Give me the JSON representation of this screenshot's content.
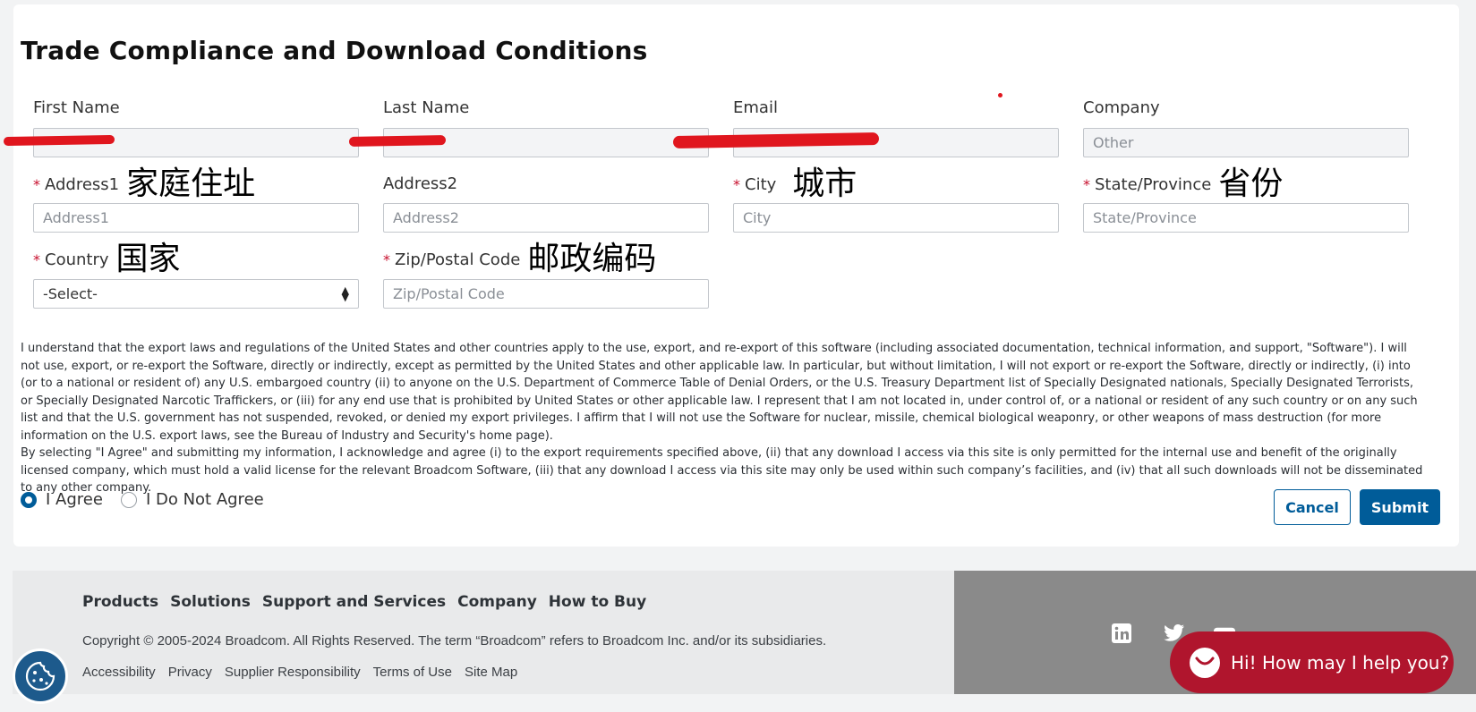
{
  "form": {
    "title": "Trade Compliance and Download Conditions",
    "fields": {
      "first_name": {
        "label": "First Name",
        "value": ""
      },
      "last_name": {
        "label": "Last Name",
        "value": ""
      },
      "email": {
        "label": "Email",
        "value": ""
      },
      "company": {
        "label": "Company",
        "placeholder": "Other"
      },
      "address1": {
        "label": "Address1",
        "note": "家庭住址",
        "placeholder": "Address1"
      },
      "address2": {
        "label": "Address2",
        "placeholder": "Address2"
      },
      "city": {
        "label": "City",
        "note": "城市",
        "placeholder": "City"
      },
      "state": {
        "label": "State/Province",
        "note": "省份",
        "placeholder": "State/Province"
      },
      "country": {
        "label": "Country",
        "note": "国家",
        "selected": "-Select-"
      },
      "zip": {
        "label": "Zip/Postal Code",
        "note": "邮政编码",
        "placeholder": "Zip/Postal Code"
      }
    },
    "required_mark": "*",
    "terms_p1": "I understand that the export laws and regulations of the United States and other countries apply to the use, export, and re-export of this software (including associated documentation, technical information, and support, \"Software\"). I will not use, export, or re-export the Software, directly or indirectly, except as permitted by the United States and other applicable law. In particular, but without limitation, I will not export or re-export the Software, directly or indirectly, (i) into (or to a national or resident of) any U.S. embargoed country (ii) to anyone on the U.S. Department of Commerce Table of Denial Orders, or the U.S. Treasury Department list of Specially Designated nationals, Specially Designated Terrorists, or Specially Designated Narcotic Traffickers, or (iii) for any end use that is prohibited by United States or other applicable law. I represent that I am not located in, under control of, or a national or resident of any such country or on any such list and that the U.S. government has not suspended, revoked, or denied my export privileges. I affirm that I will not use the Software for nuclear, missile, chemical biological weaponry, or other weapons of mass destruction (for more information on the U.S. export laws, see the Bureau of Industry and Security's home page).",
    "terms_p2": "By selecting \"I Agree\" and submitting my information, I acknowledge and agree (i) to the export requirements specified above, (ii) that any download I access via this site is only permitted for the internal use and benefit of the originally licensed company, which must hold a valid license for the relevant Broadcom Software, (iii) that any download I access via this site may only be used within such company’s facilities, and (iv) that all such downloads will not be disseminated to any other company.",
    "agree_label": "I Agree",
    "disagree_label": "I Do Not Agree",
    "agree_selected": true,
    "cancel_label": "Cancel",
    "submit_label": "Submit"
  },
  "footer": {
    "nav": [
      "Products",
      "Solutions",
      "Support and Services",
      "Company",
      "How to Buy"
    ],
    "copyright": "Copyright © 2005-2024 Broadcom. All Rights Reserved. The term “Broadcom” refers to Broadcom Inc. and/or its subsidiaries.",
    "links": [
      "Accessibility",
      "Privacy",
      "Supplier Responsibility",
      "Terms of Use",
      "Site Map"
    ],
    "social_icons": [
      "linkedin-icon",
      "twitter-icon",
      "youtube-icon"
    ]
  },
  "chat": {
    "label": "Hi! How may I help you?"
  },
  "colors": {
    "accent": "#005c99",
    "required": "#c8102e",
    "chat": "#b0152d",
    "redaction": "#e0161e"
  }
}
